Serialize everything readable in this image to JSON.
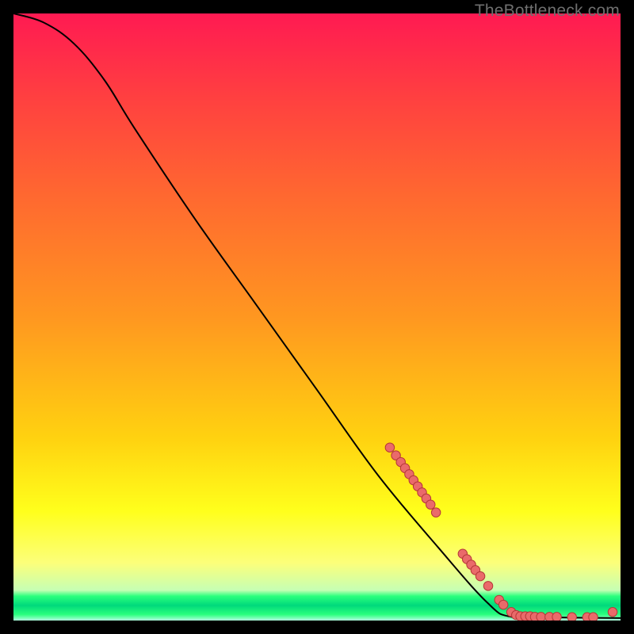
{
  "watermark": "TheBottleneck.com",
  "chart_data": {
    "type": "line",
    "title": "",
    "xlabel": "",
    "ylabel": "",
    "xlim": [
      0,
      100
    ],
    "ylim": [
      0,
      100
    ],
    "curve": [
      {
        "x": 0,
        "y": 100
      },
      {
        "x": 5,
        "y": 98.5
      },
      {
        "x": 10,
        "y": 95
      },
      {
        "x": 15,
        "y": 89
      },
      {
        "x": 20,
        "y": 81
      },
      {
        "x": 30,
        "y": 66
      },
      {
        "x": 40,
        "y": 52
      },
      {
        "x": 50,
        "y": 38
      },
      {
        "x": 60,
        "y": 24
      },
      {
        "x": 70,
        "y": 12
      },
      {
        "x": 78,
        "y": 3
      },
      {
        "x": 82,
        "y": 0.6
      },
      {
        "x": 90,
        "y": 0.5
      },
      {
        "x": 100,
        "y": 0.4
      }
    ],
    "markers_upper": [
      {
        "x": 62,
        "y": 28.5
      },
      {
        "x": 63,
        "y": 27.2
      },
      {
        "x": 63.8,
        "y": 26.1
      },
      {
        "x": 64.5,
        "y": 25.1
      },
      {
        "x": 65.2,
        "y": 24.1
      },
      {
        "x": 65.9,
        "y": 23.1
      },
      {
        "x": 66.6,
        "y": 22.1
      },
      {
        "x": 67.3,
        "y": 21.1
      },
      {
        "x": 68,
        "y": 20.1
      },
      {
        "x": 68.7,
        "y": 19.1
      },
      {
        "x": 69.6,
        "y": 17.8
      }
    ],
    "markers_mid": [
      {
        "x": 74.0,
        "y": 11.0
      },
      {
        "x": 74.7,
        "y": 10.1
      },
      {
        "x": 75.4,
        "y": 9.2
      },
      {
        "x": 76.1,
        "y": 8.3
      },
      {
        "x": 76.9,
        "y": 7.3
      },
      {
        "x": 78.2,
        "y": 5.7
      }
    ],
    "markers_lower": [
      {
        "x": 80.0,
        "y": 3.4
      },
      {
        "x": 80.7,
        "y": 2.6
      },
      {
        "x": 82.0,
        "y": 1.4
      },
      {
        "x": 82.8,
        "y": 0.9
      },
      {
        "x": 83.5,
        "y": 0.7
      },
      {
        "x": 84.3,
        "y": 0.7
      },
      {
        "x": 85.1,
        "y": 0.7
      },
      {
        "x": 85.9,
        "y": 0.6
      },
      {
        "x": 86.9,
        "y": 0.6
      },
      {
        "x": 88.3,
        "y": 0.6
      },
      {
        "x": 89.5,
        "y": 0.6
      },
      {
        "x": 92.0,
        "y": 0.55
      },
      {
        "x": 94.5,
        "y": 0.55
      },
      {
        "x": 95.5,
        "y": 0.55
      },
      {
        "x": 98.7,
        "y": 1.4
      }
    ],
    "marker_color": "#ea6a6a",
    "marker_stroke": "#b53838",
    "marker_radius_data": 0.75,
    "curve_stroke": "#000000",
    "curve_width": 2
  }
}
